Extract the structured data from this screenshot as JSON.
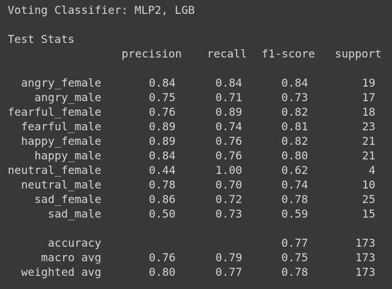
{
  "title": "Voting Classifier: MLP2, LGB",
  "section_title": "Test Stats",
  "headers": {
    "precision": "precision",
    "recall": "recall",
    "f1": "f1-score",
    "support": "support"
  },
  "rows": [
    {
      "label": "angry_female",
      "precision": "0.84",
      "recall": "0.84",
      "f1": "0.84",
      "support": "19"
    },
    {
      "label": "angry_male",
      "precision": "0.75",
      "recall": "0.71",
      "f1": "0.73",
      "support": "17"
    },
    {
      "label": "fearful_female",
      "precision": "0.76",
      "recall": "0.89",
      "f1": "0.82",
      "support": "18"
    },
    {
      "label": "fearful_male",
      "precision": "0.89",
      "recall": "0.74",
      "f1": "0.81",
      "support": "23"
    },
    {
      "label": "happy_female",
      "precision": "0.89",
      "recall": "0.76",
      "f1": "0.82",
      "support": "21"
    },
    {
      "label": "happy_male",
      "precision": "0.84",
      "recall": "0.76",
      "f1": "0.80",
      "support": "21"
    },
    {
      "label": "neutral_female",
      "precision": "0.44",
      "recall": "1.00",
      "f1": "0.62",
      "support": "4"
    },
    {
      "label": "neutral_male",
      "precision": "0.78",
      "recall": "0.70",
      "f1": "0.74",
      "support": "10"
    },
    {
      "label": "sad_female",
      "precision": "0.86",
      "recall": "0.72",
      "f1": "0.78",
      "support": "25"
    },
    {
      "label": "sad_male",
      "precision": "0.50",
      "recall": "0.73",
      "f1": "0.59",
      "support": "15"
    }
  ],
  "summary": [
    {
      "label": "accuracy",
      "precision": "",
      "recall": "",
      "f1": "0.77",
      "support": "173"
    },
    {
      "label": "macro avg",
      "precision": "0.76",
      "recall": "0.79",
      "f1": "0.75",
      "support": "173"
    },
    {
      "label": "weighted avg",
      "precision": "0.80",
      "recall": "0.77",
      "f1": "0.78",
      "support": "173"
    }
  ]
}
